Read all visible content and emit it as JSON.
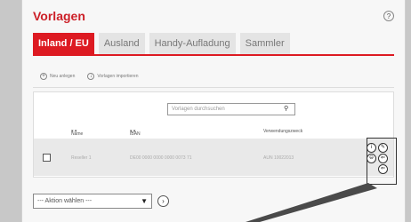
{
  "header": {
    "title": "Vorlagen",
    "help": "?"
  },
  "tabs": [
    {
      "label": "Inland / EU"
    },
    {
      "label": "Ausland"
    },
    {
      "label": "Handy-Aufladung"
    },
    {
      "label": "Sammler"
    }
  ],
  "actions": [
    {
      "label": "Neu anlegen",
      "icon": "+"
    },
    {
      "label": "Vorlagen importieren",
      "icon": "↓"
    }
  ],
  "search": {
    "placeholder": "Vorlagen durchsuchen"
  },
  "table": {
    "columns": [
      "Name",
      "IBAN",
      "Verwendungszweck"
    ],
    "row": {
      "name": "Reseller 1",
      "iban": "DE00 0000 0000 0000 0073 71",
      "purpose": "AUN 10022013"
    }
  },
  "row_icons": [
    "i",
    "✎",
    "⊖",
    "⇐",
    "⇐"
  ],
  "bulk": {
    "selected": "--- Aktion wählen ---",
    "go": "›"
  }
}
